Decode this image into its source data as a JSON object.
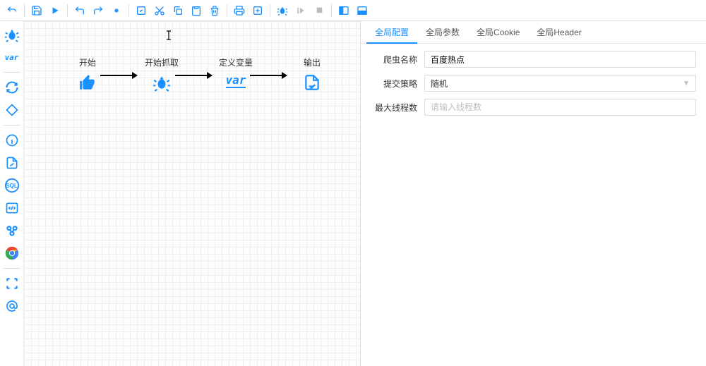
{
  "toolbar": {
    "undo": "undo",
    "redo": "redo",
    "save": "save",
    "run": "run",
    "back": "back",
    "fwd": "fwd",
    "sel": "sel",
    "cut": "cut",
    "copy": "copy",
    "paste": "paste",
    "del": "del",
    "print": "print",
    "export": "export",
    "debug": "debug",
    "step": "step",
    "stop": "stop",
    "split_v": "split_v",
    "split_h": "split_h"
  },
  "palette": {
    "bug": "bug",
    "var_text": "var",
    "loop": "loop",
    "diamond": "diamond",
    "info": "info",
    "file": "file",
    "sql_text": "SQL",
    "code": "code",
    "link": "link",
    "chrome": "chrome",
    "capture": "capture",
    "at": "at"
  },
  "canvas": {
    "nodes": [
      {
        "label": "开始"
      },
      {
        "label": "开始抓取"
      },
      {
        "label": "定义变量"
      },
      {
        "label": "输出"
      }
    ]
  },
  "right": {
    "tabs": [
      {
        "label": "全局配置",
        "active": true
      },
      {
        "label": "全局参数",
        "active": false
      },
      {
        "label": "全局Cookie",
        "active": false
      },
      {
        "label": "全局Header",
        "active": false
      }
    ],
    "form": {
      "name_label": "爬虫名称",
      "name_value": "百度热点",
      "strategy_label": "提交策略",
      "strategy_value": "随机",
      "threads_label": "最大线程数",
      "threads_placeholder": "请输入线程数"
    }
  }
}
